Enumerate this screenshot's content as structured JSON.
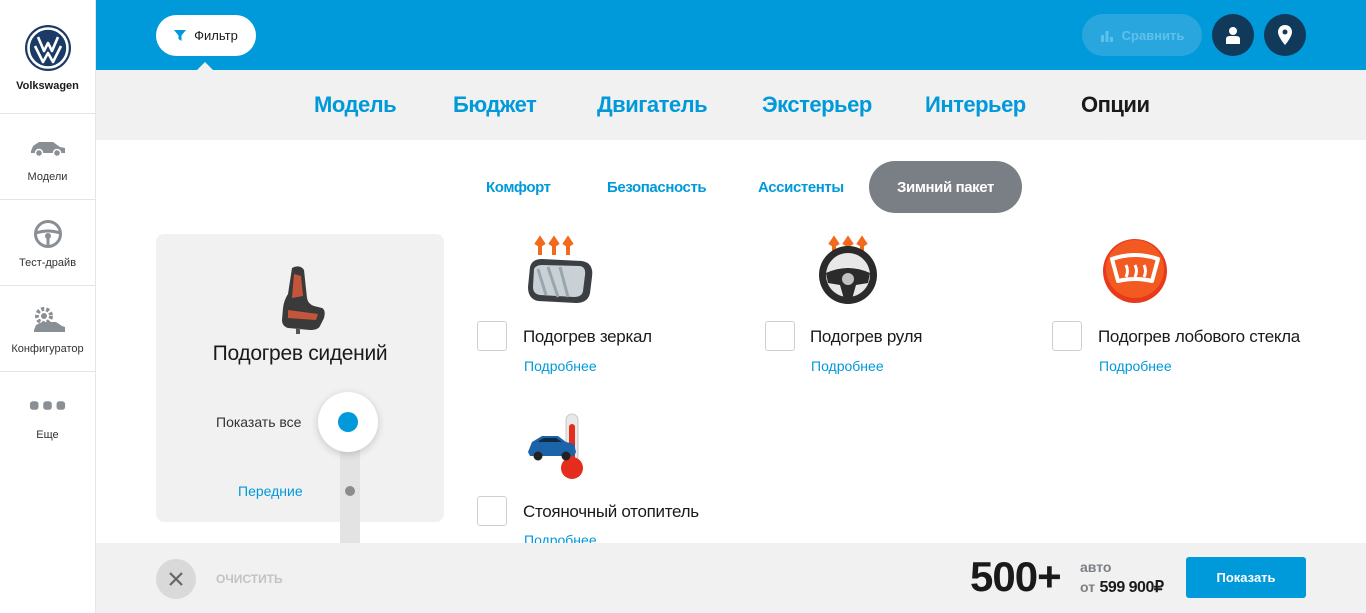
{
  "sidebar": {
    "brand": "Volkswagen",
    "items": [
      {
        "label": "Модели",
        "icon": "car-icon"
      },
      {
        "label": "Тест-драйв",
        "icon": "steering-wheel-icon"
      },
      {
        "label": "Конфигуратор",
        "icon": "configurator-icon"
      },
      {
        "label": "Еще",
        "icon": "more-dots-icon"
      }
    ]
  },
  "header": {
    "filter_label": "Фильтр",
    "compare_label": "Сравнить",
    "accent": "#0099da"
  },
  "tabs": [
    "Модель",
    "Бюджет",
    "Двигатель",
    "Экстерьер",
    "Интерьер",
    "Опции"
  ],
  "active_tab": "Опции",
  "subtabs": [
    "Комфорт",
    "Безопасность",
    "Ассистенты",
    "Зимний пакет"
  ],
  "active_subtab": "Зимний пакет",
  "card": {
    "title": "Подогрев сидений",
    "show_all": "Показать все",
    "front": "Передние"
  },
  "options": [
    {
      "label": "Подогрев зеркал",
      "more": "Подробнее",
      "icon": "heated-mirror-icon"
    },
    {
      "label": "Подогрев руля",
      "more": "Подробнее",
      "icon": "heated-steering-icon"
    },
    {
      "label": "Подогрев лобового стекла",
      "more": "Подробнее",
      "icon": "heated-windshield-icon"
    },
    {
      "label": "Стояночный отопитель",
      "more": "Подробнее",
      "icon": "parking-heater-icon"
    }
  ],
  "bottom": {
    "clear_label": "ОЧИСТИТЬ",
    "count": "500+",
    "count_unit": "авто",
    "price_from": "от",
    "price": "599 900₽",
    "show_label": "Показать"
  }
}
